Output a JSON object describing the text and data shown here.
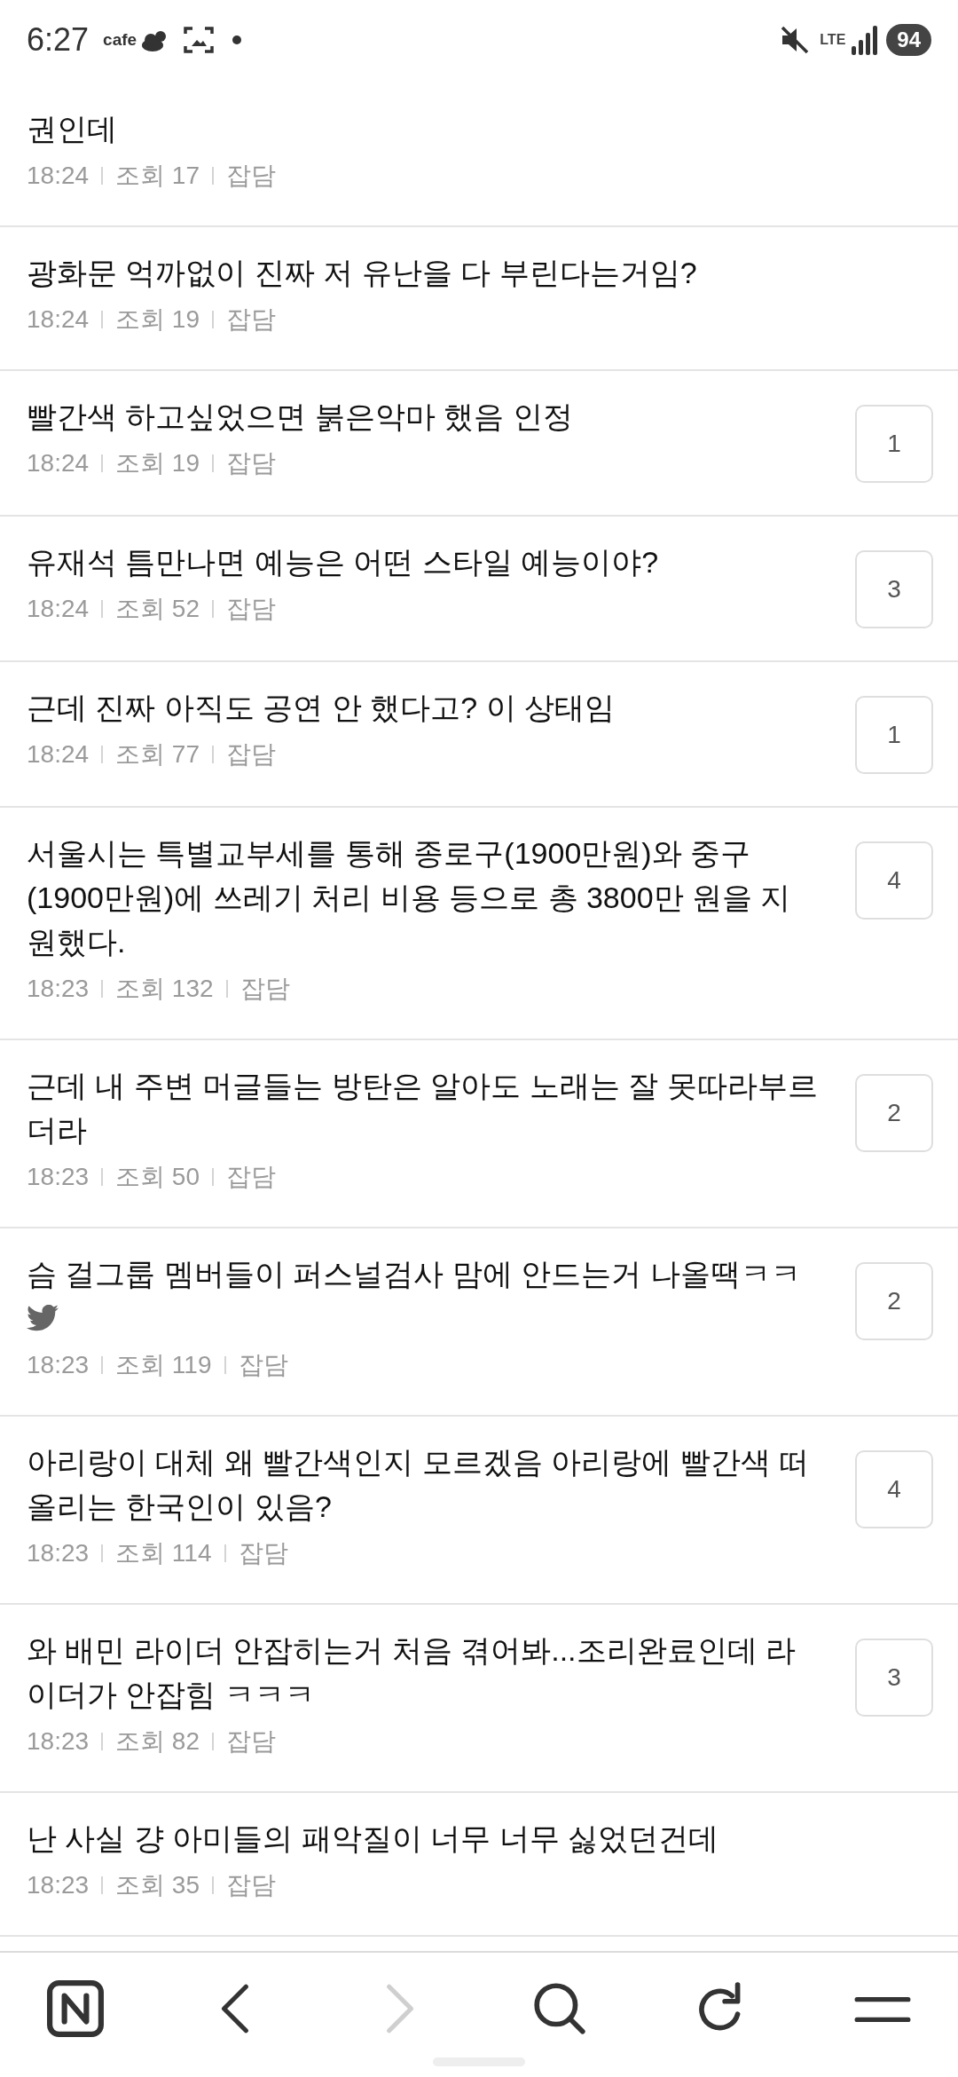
{
  "status_bar": {
    "time": "6:27",
    "app_label": "cafe",
    "network": "LTE",
    "battery": "94"
  },
  "posts": [
    {
      "title": "권인데",
      "time": "18:24",
      "views": "조회 17",
      "category": "잡담"
    },
    {
      "title": "광화문 억까없이 진짜 저 유난을 다 부린다는거임?",
      "time": "18:24",
      "views": "조회 19",
      "category": "잡담"
    },
    {
      "title": "빨간색 하고싶었으면 붉은악마 했음 인정",
      "time": "18:24",
      "views": "조회 19",
      "category": "잡담",
      "comments": "1"
    },
    {
      "title": "유재석 틈만나면 예능은 어떤 스타일 예능이야?",
      "time": "18:24",
      "views": "조회 52",
      "category": "잡담",
      "comments": "3"
    },
    {
      "title": "근데 진짜 아직도 공연 안 했다고? 이 상태임",
      "time": "18:24",
      "views": "조회 77",
      "category": "잡담",
      "comments": "1"
    },
    {
      "title": "서울시는 특별교부세를 통해 종로구(1900만원)와 중구(1900만원)에 쓰레기 처리 비용 등으로 총 3800만 원을 지원했다.",
      "time": "18:23",
      "views": "조회 132",
      "category": "잡담",
      "comments": "4"
    },
    {
      "title": "근데 내 주변 머글들는 방탄은 알아도 노래는 잘 못따라부르더라",
      "time": "18:23",
      "views": "조회 50",
      "category": "잡담",
      "comments": "2"
    },
    {
      "title": "슴 걸그룹 멤버들이 퍼스널검사 맘에 안드는거 나올땍ㅋㅋ",
      "time": "18:23",
      "views": "조회 119",
      "category": "잡담",
      "comments": "2",
      "kind": "with_bird_icon"
    },
    {
      "title": "아리랑이 대체 왜 빨간색인지 모르겠음 아리랑에 빨간색 떠올리는 한국인이 있음?",
      "time": "18:23",
      "views": "조회 114",
      "category": "잡담",
      "comments": "4"
    },
    {
      "title": "와 배민 라이더 안잡히는거 처음 겪어봐...조리완료인데 라이더가 안잡힘 ㅋㅋㅋ",
      "time": "18:23",
      "views": "조회 82",
      "category": "잡담",
      "comments": "3"
    },
    {
      "title": "난 사실 걍 아미들의 패악질이 너무 너무 싫었던건데",
      "time": "18:23",
      "views": "조회 35",
      "category": "잡담"
    }
  ],
  "nav": [
    {
      "kind": "home",
      "disabled": false
    },
    {
      "kind": "back",
      "disabled": false
    },
    {
      "kind": "forward",
      "disabled": true
    },
    {
      "kind": "search",
      "disabled": false
    },
    {
      "kind": "reload",
      "disabled": false
    },
    {
      "kind": "menu",
      "disabled": false
    }
  ]
}
